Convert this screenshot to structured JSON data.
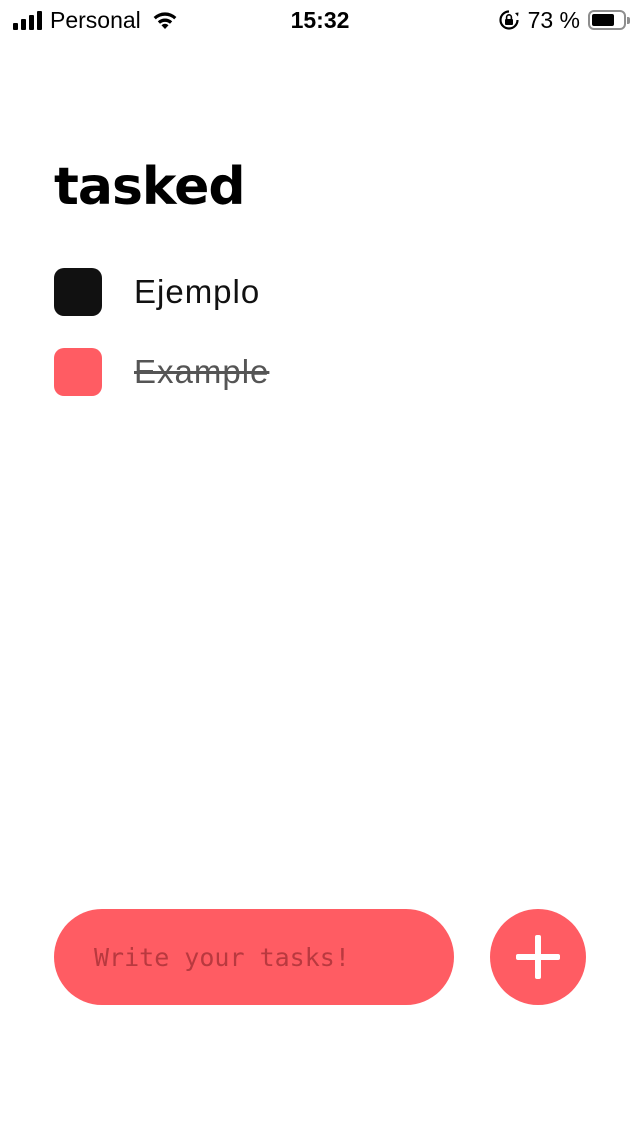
{
  "status_bar": {
    "carrier": "Personal",
    "time": "15:32",
    "battery_percent": "73 %",
    "battery_level": 0.73,
    "icons": [
      "signal-icon",
      "wifi-icon",
      "orientation-lock-icon",
      "battery-icon"
    ]
  },
  "app": {
    "title": "tasked"
  },
  "tasks": [
    {
      "label": "Ejemplo",
      "done": false
    },
    {
      "label": "Example",
      "done": true
    }
  ],
  "input": {
    "placeholder": "Write your tasks!",
    "value": ""
  },
  "add_button": {
    "icon": "plus-icon"
  },
  "colors": {
    "accent": "#ff5c63",
    "checkbox_default": "#111111",
    "placeholder_text": "#b9393f",
    "background": "#ffffff"
  }
}
